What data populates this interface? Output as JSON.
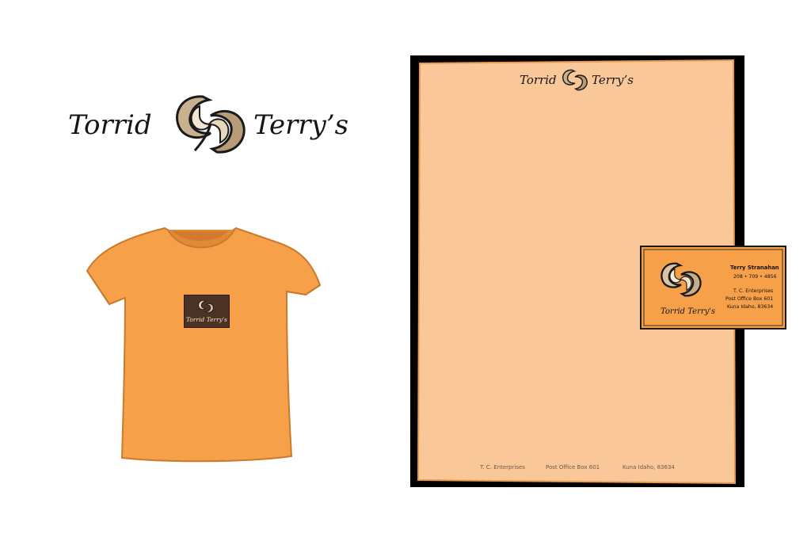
{
  "logo": {
    "word_left": "Torrid",
    "word_right": "Terry’s",
    "emblem_icon": "swirl-emblem-icon"
  },
  "tshirt": {
    "color": "#f6a14a",
    "badge_text": "Torrid Terry's"
  },
  "letterhead": {
    "paper_color": "#fac898",
    "border_color": "#000000",
    "footer": {
      "company": "T. C. Enterprises",
      "po_box": "Post Office Box 601",
      "city": "Kuna Idaho, 83634"
    }
  },
  "business_card": {
    "background_color": "#f6a14a",
    "logo_text": "Torrid Terry's",
    "name": "Terry Stranahan",
    "phone": "208 • 709 • 4856",
    "company": "T. C. Enterprises",
    "po_box": "Post Office Box 601",
    "city": "Kuna Idaho, 83634"
  }
}
